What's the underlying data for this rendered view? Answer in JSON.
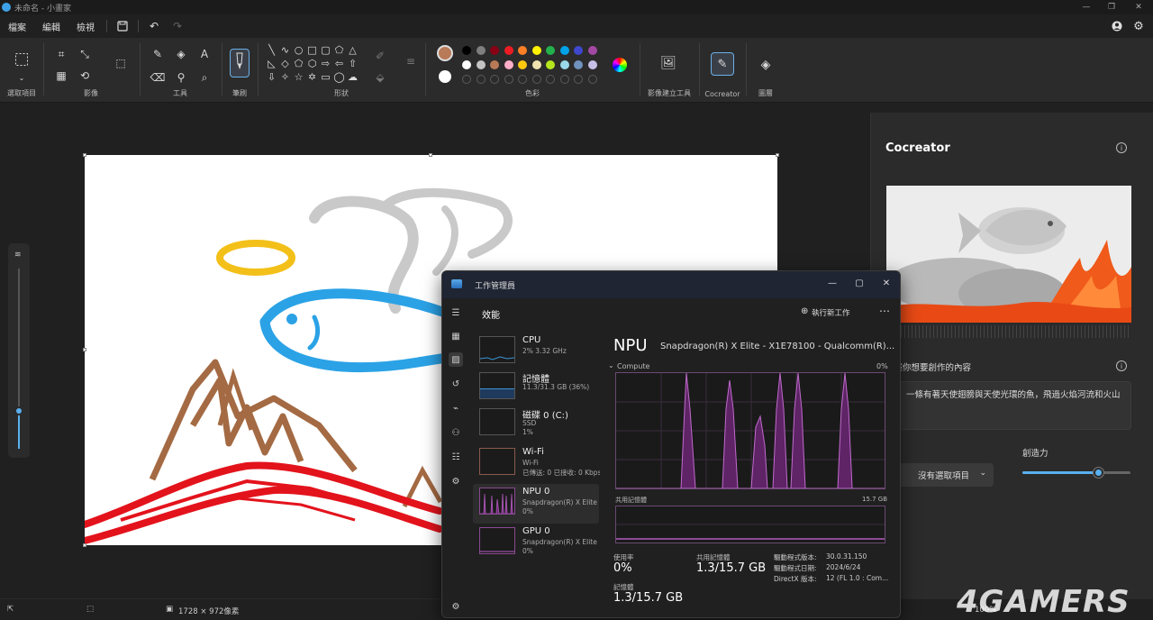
{
  "window": {
    "title": "未命名 - 小畫家"
  },
  "menu": {
    "file": "檔案",
    "edit": "編輯",
    "view": "檢視"
  },
  "ribbon": {
    "groups": {
      "select": "選取項目",
      "image": "影像",
      "tools": "工具",
      "brushes": "筆刷",
      "shapes": "形狀",
      "colors": "色彩",
      "image_creator": "影像建立工具",
      "cocreator": "Cocreator",
      "layers": "圖層"
    },
    "colors_row1": [
      "#000000",
      "#7f7f7f",
      "#880015",
      "#ed1c24",
      "#ff7f27",
      "#fff200",
      "#22b14c",
      "#00a2e8",
      "#3f48cc",
      "#a349a4"
    ],
    "colors_row2": [
      "#ffffff",
      "#c3c3c3",
      "#b97a57",
      "#ffaec9",
      "#ffc90e",
      "#efe4b0",
      "#b5e61d",
      "#99d9ea",
      "#7092be",
      "#c8bfe7"
    ],
    "primary_color": "#b97a57",
    "secondary_color": "#ffffff"
  },
  "cocreator": {
    "title": "Cocreator",
    "prompt_label": "描述你想要創作的內容",
    "prompt_text": "一條有著天使翅膀與天使光環的魚，飛過火焰河流和火山",
    "style_dropdown": "沒有選取項目",
    "creativity_label": "創造力",
    "creativity_value": 0.7
  },
  "status": {
    "canvas_size": "1728 × 972像素",
    "zoom": "100%"
  },
  "taskmgr": {
    "title": "工作管理員",
    "section": "效能",
    "run_new_task": "執行新工作",
    "items": [
      {
        "name": "CPU",
        "sub1": "2% 3.32 GHz",
        "sub2": ""
      },
      {
        "name": "記憶體",
        "sub1": "11.3/31.3 GB (36%)",
        "sub2": ""
      },
      {
        "name": "磁碟 0 (C:)",
        "sub1": "SSD",
        "sub2": "1%"
      },
      {
        "name": "Wi-Fi",
        "sub1": "Wi-Fi",
        "sub2": "已傳送: 0 已接收: 0 Kbps"
      },
      {
        "name": "NPU 0",
        "sub1": "Snapdragon(R) X Elite",
        "sub2": "0%"
      },
      {
        "name": "GPU 0",
        "sub1": "Snapdragon(R) X Elite",
        "sub2": "0%"
      }
    ],
    "detail": {
      "heading": "NPU",
      "device": "Snapdragon(R) X Elite - X1E78100 - Qualcomm(R)...",
      "graph_label": "Compute",
      "graph_max": "0%",
      "shared_mem_label": "共用記憶體",
      "shared_mem_max": "15.7 GB",
      "utilization_label": "使用率",
      "utilization_value": "0%",
      "shared_label": "共用記憶體",
      "shared_value": "1.3/15.7 GB",
      "memory_label": "記憶體",
      "memory_value": "1.3/15.7 GB",
      "driver_version_label": "驅動程式版本:",
      "driver_version": "30.0.31.150",
      "driver_date_label": "驅動程式日期:",
      "driver_date": "2024/6/24",
      "directx_label": "DirectX 版本:",
      "directx": "12 (FL 1.0 : Com..."
    }
  },
  "watermark": "4GAMERS"
}
